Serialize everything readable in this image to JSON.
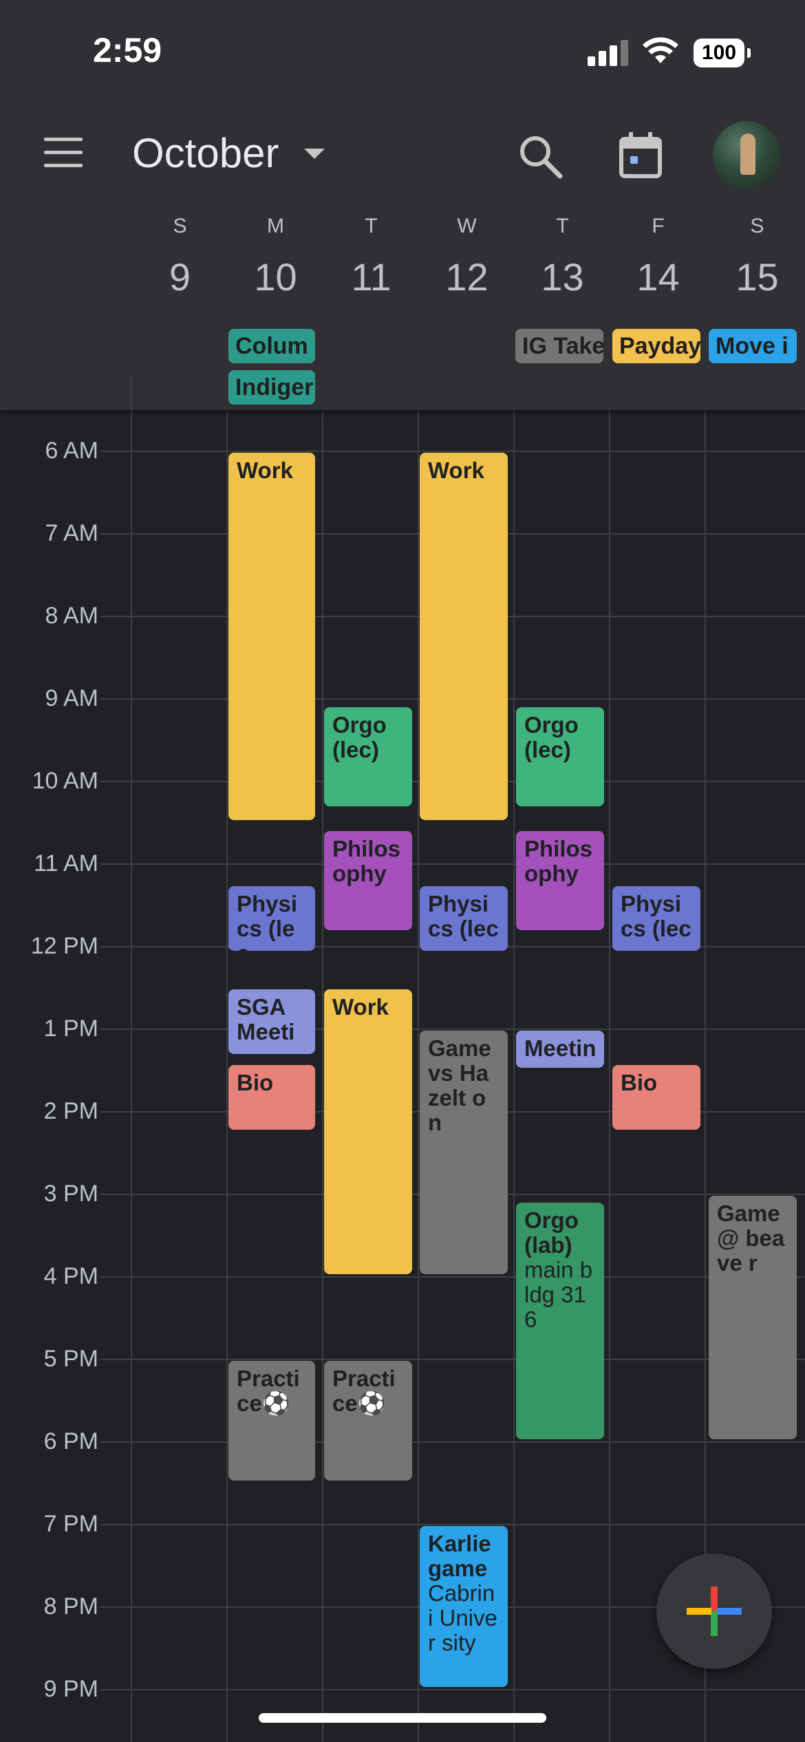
{
  "status_bar": {
    "time": "2:59",
    "battery": "100"
  },
  "header": {
    "month": "October",
    "days": [
      {
        "dow": "S",
        "num": "9"
      },
      {
        "dow": "M",
        "num": "10"
      },
      {
        "dow": "T",
        "num": "11"
      },
      {
        "dow": "W",
        "num": "12"
      },
      {
        "dow": "T",
        "num": "13"
      },
      {
        "dow": "F",
        "num": "14"
      },
      {
        "dow": "S",
        "num": "15"
      }
    ],
    "all_day": [
      {
        "title": "Colum",
        "color": "#2d9b8b"
      },
      {
        "title": "Indiger",
        "color": "#2d9b8b"
      },
      {
        "title": "IG Take",
        "color": "#757575"
      },
      {
        "title": "Payday",
        "color": "#f2c14e"
      },
      {
        "title": "Move i",
        "color": "#2ba3e8"
      }
    ]
  },
  "hours": [
    "6 AM",
    "7 AM",
    "8 AM",
    "9 AM",
    "10 AM",
    "11 AM",
    "12 PM",
    "1 PM",
    "2 PM",
    "3 PM",
    "4 PM",
    "5 PM",
    "6 PM",
    "7 PM",
    "8 PM",
    "9 PM"
  ],
  "events": [
    {
      "title": "Work",
      "detail": "",
      "color": "#f0c24c"
    },
    {
      "title": "Work",
      "detail": "",
      "color": "#f0c24c"
    },
    {
      "title": "Orgo (lec)",
      "detail": "",
      "color": "#3fb47d"
    },
    {
      "title": "Orgo (lec)",
      "detail": "",
      "color": "#3fb47d"
    },
    {
      "title": "Philos ophy",
      "detail": "",
      "color": "#a551bc"
    },
    {
      "title": "Philos ophy",
      "detail": "",
      "color": "#a551bc"
    },
    {
      "title": "Physi cs (lec",
      "detail": "",
      "color": "#6b76d0"
    },
    {
      "title": "Physi cs (lec",
      "detail": "",
      "color": "#6b76d0"
    },
    {
      "title": "Physi cs (lec",
      "detail": "",
      "color": "#6b76d0"
    },
    {
      "title": "SGA Meeti",
      "detail": "",
      "color": "#8a92dc"
    },
    {
      "title": "Work",
      "detail": "",
      "color": "#f0c24c"
    },
    {
      "title": "Game vs Hazelt on",
      "detail": "",
      "color": "#757575"
    },
    {
      "title": "Meetin",
      "detail": "",
      "color": "#8a92dc"
    },
    {
      "title": "Bio",
      "detail": "",
      "color": "#e6827a"
    },
    {
      "title": "Bio",
      "detail": "",
      "color": "#e6827a"
    },
    {
      "title": "Orgo (lab)",
      "detail": "main bldg 316",
      "color": "#379665"
    },
    {
      "title": "Game @ beave r",
      "detail": "",
      "color": "#757575"
    },
    {
      "title": "Practi ce⚽",
      "detail": "",
      "color": "#757575"
    },
    {
      "title": "Practi ce⚽",
      "detail": "",
      "color": "#757575"
    },
    {
      "title": "Karlie game",
      "detail": "Cabrin i Univer sity",
      "color": "#2ba3e8"
    }
  ]
}
